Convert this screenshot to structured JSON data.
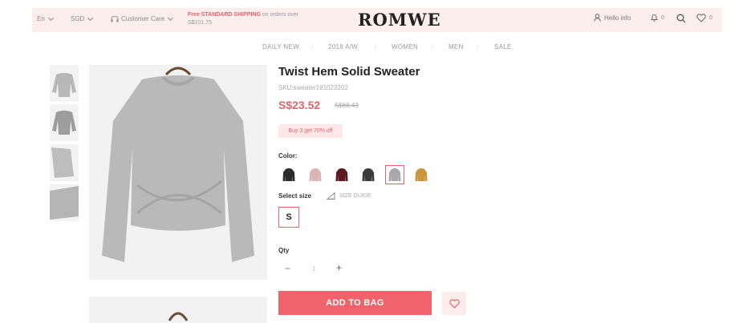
{
  "topbar": {
    "language": "En",
    "currency": "SGD",
    "customer_care": "Customer Care",
    "promo_highlight": "Free STANDARD SHIPPING",
    "promo_rest": " on orders over",
    "promo_line2": "S$101.75",
    "logo": "ROMWE",
    "hello": "Hello info",
    "notification_count": "0",
    "wishlist_count": "0"
  },
  "nav": [
    "DAILY NEW",
    "2018 A/W",
    "WOMEN",
    "MEN",
    "SALE"
  ],
  "product": {
    "title": "Twist Hem Solid Sweater",
    "sku": "SKU:sweater181023202",
    "price": "S$23.52",
    "old_price": "S$66.43",
    "promo_tag": "Buy 3 get 70% off",
    "color_label": "Color:",
    "size_label": "Select size",
    "size_guide": "SIZE GUIDE",
    "size": "S",
    "qty_label": "Qty",
    "qty_value": "1",
    "qty_minus": "−",
    "qty_plus": "+",
    "add_to_bag": "ADD TO BAG"
  },
  "colors": [
    {
      "name": "black",
      "hex": "#2b2b2b"
    },
    {
      "name": "pink",
      "hex": "#d9b6b4"
    },
    {
      "name": "burgundy",
      "hex": "#5b1a22"
    },
    {
      "name": "charcoal",
      "hex": "#3c3c3c"
    },
    {
      "name": "grey",
      "hex": "#a8a8a8",
      "selected": true
    },
    {
      "name": "mustard",
      "hex": "#c9973a"
    }
  ],
  "accent": "#e8616b"
}
